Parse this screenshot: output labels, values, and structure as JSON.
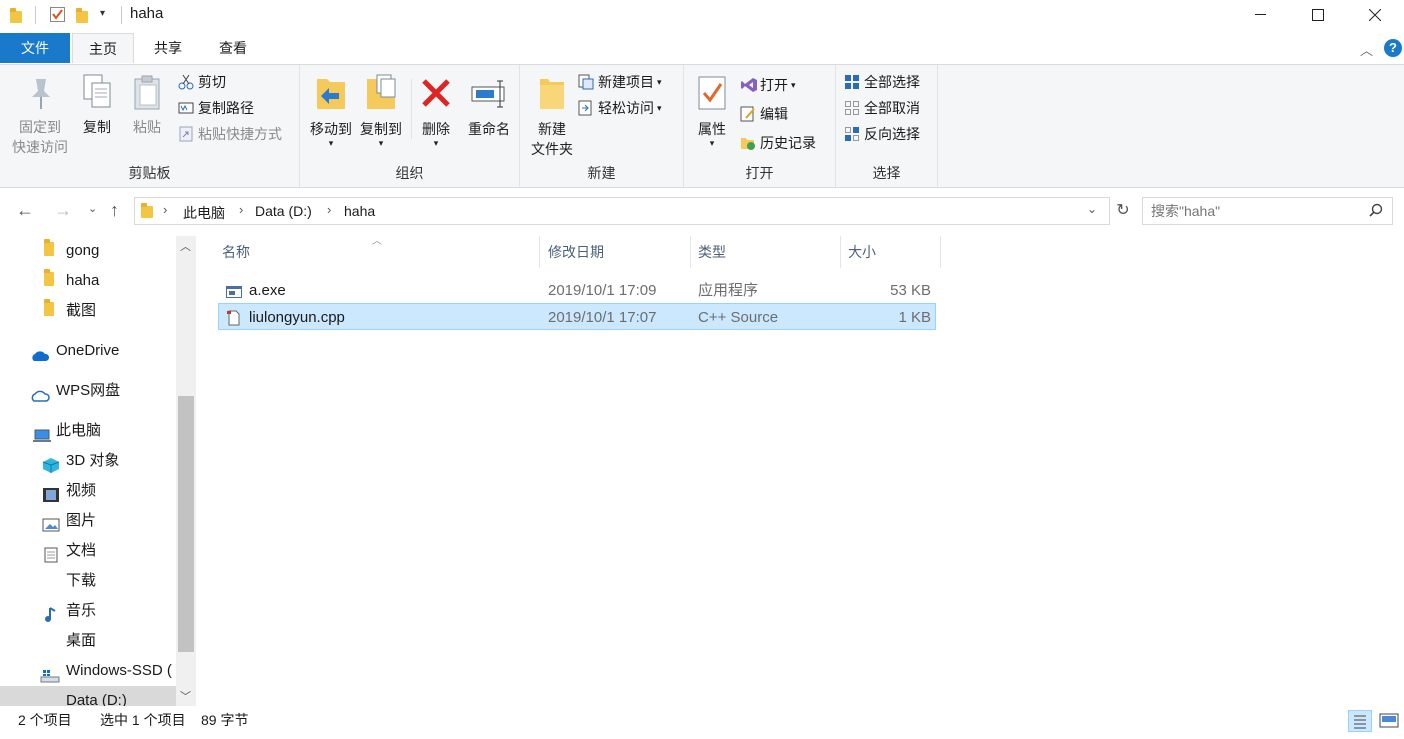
{
  "window": {
    "title": "haha"
  },
  "tabs": {
    "file": "文件",
    "home": "主页",
    "share": "共享",
    "view": "查看"
  },
  "ribbon": {
    "clipboard": {
      "label": "剪贴板",
      "pin_line1": "固定到",
      "pin_line2": "快速访问",
      "copy": "复制",
      "paste": "粘贴",
      "cut": "剪切",
      "copy_path": "复制路径",
      "paste_shortcut": "粘贴快捷方式"
    },
    "organize": {
      "label": "组织",
      "move_to": "移动到",
      "copy_to": "复制到",
      "delete": "删除",
      "rename": "重命名"
    },
    "new": {
      "label": "新建",
      "new_folder_line1": "新建",
      "new_folder_line2": "文件夹",
      "new_item": "新建项目",
      "easy_access": "轻松访问"
    },
    "open": {
      "label": "打开",
      "properties": "属性",
      "open": "打开",
      "edit": "编辑",
      "history": "历史记录"
    },
    "select": {
      "label": "选择",
      "select_all": "全部选择",
      "select_none": "全部取消",
      "invert": "反向选择"
    }
  },
  "address": {
    "crumbs": [
      "此电脑",
      "Data (D:)",
      "haha"
    ],
    "search_placeholder": "搜索\"haha\""
  },
  "nav": {
    "items": [
      "gong",
      "haha",
      "截图",
      "OneDrive",
      "WPS网盘",
      "此电脑",
      "3D 对象",
      "视频",
      "图片",
      "文档",
      "下载",
      "音乐",
      "桌面",
      "Windows-SSD (",
      "Data (D:)"
    ]
  },
  "columns": {
    "name": "名称",
    "date": "修改日期",
    "type": "类型",
    "size": "大小"
  },
  "files": [
    {
      "name": "a.exe",
      "date": "2019/10/1 17:09",
      "type": "应用程序",
      "size": "53 KB"
    },
    {
      "name": "liulongyun.cpp",
      "date": "2019/10/1 17:07",
      "type": "C++ Source",
      "size": "1 KB"
    }
  ],
  "status": {
    "count": "2 个项目",
    "selected": "选中 1 个项目",
    "bytes": "89 字节"
  },
  "colors": {
    "accent": "#1979ca",
    "selection": "#cce8ff",
    "selection_border": "#99d1ff"
  }
}
